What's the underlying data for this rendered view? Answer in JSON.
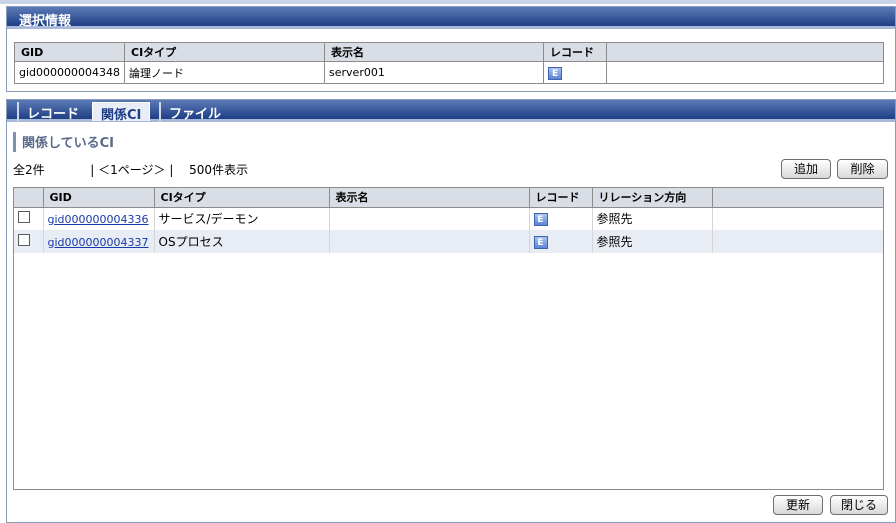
{
  "selection_panel": {
    "title": "選択情報",
    "columns": [
      "GID",
      "CIタイプ",
      "表示名",
      "レコード"
    ],
    "row": {
      "gid": "gid000000004348",
      "ci_type": "論理ノード",
      "display_name": "server001",
      "record_icon": "E"
    }
  },
  "tabs": [
    {
      "label": "レコード",
      "active": false
    },
    {
      "label": "関係CI",
      "active": true
    },
    {
      "label": "ファイル",
      "active": false
    }
  ],
  "section_title": "関係しているCI",
  "pager": {
    "total": "全2件",
    "page": "| ＜1ページ＞ |",
    "per_page": "500件表示"
  },
  "buttons": {
    "add": "追加",
    "delete": "削除",
    "refresh": "更新",
    "close": "閉じる"
  },
  "grid": {
    "columns": [
      "GID",
      "CIタイプ",
      "表示名",
      "レコード",
      "リレーション方向"
    ],
    "rows": [
      {
        "gid": "gid000000004336",
        "ci_type": "サービス/デーモン",
        "display_name": "",
        "record_icon": "E",
        "direction": "参照先"
      },
      {
        "gid": "gid000000004337",
        "ci_type": "OSプロセス",
        "display_name": "",
        "record_icon": "E",
        "direction": "参照先"
      }
    ]
  }
}
